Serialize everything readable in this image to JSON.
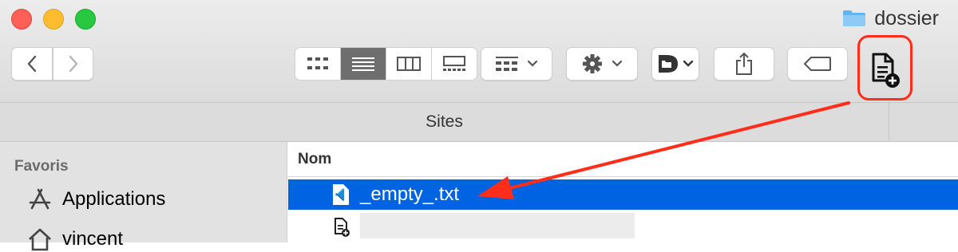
{
  "window": {
    "title": "dossier"
  },
  "path_title": "Sites",
  "sidebar": {
    "section": "Favoris",
    "items": [
      {
        "label": "Applications"
      },
      {
        "label": "vincent"
      }
    ]
  },
  "list": {
    "column_name": "Nom",
    "rows": [
      {
        "name": "_empty_.txt",
        "selected": true
      },
      {
        "name": "",
        "selected": false
      }
    ]
  },
  "toolbar": {
    "view_modes": [
      "icons",
      "list",
      "columns",
      "gallery"
    ],
    "active_view": "list"
  },
  "annotation_color": "#ff2d19",
  "selection_color": "#0063e1"
}
